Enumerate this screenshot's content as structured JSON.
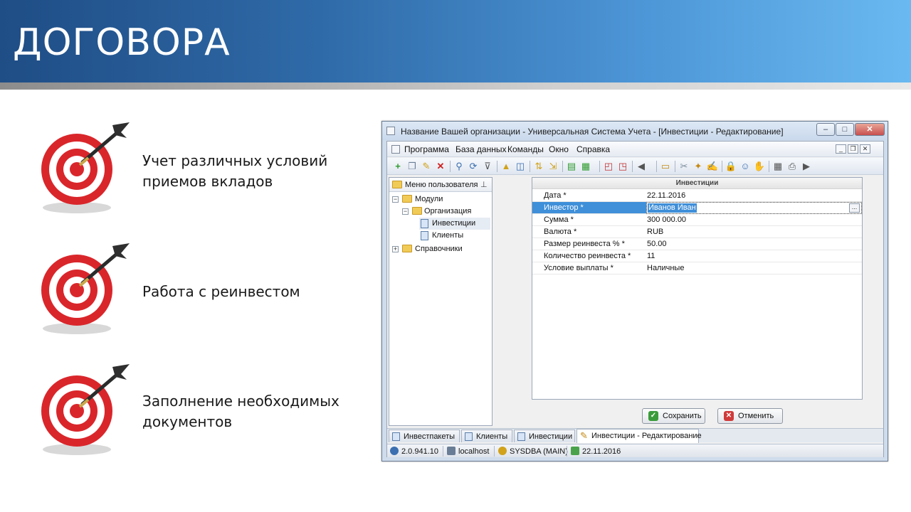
{
  "slide": {
    "title": "ДОГОВОРА",
    "bullets": [
      {
        "line1": "Учет различных условий",
        "line2": "приемов вкладов"
      },
      {
        "line1": "Работа с реинвестом",
        "line2": ""
      },
      {
        "line1": "Заполнение необходимых",
        "line2": "документов"
      }
    ]
  },
  "window": {
    "title": "Название Вашей организации - Универсальная Система Учета - [Инвестиции - Редактирование]",
    "controls": {
      "minimize": "–",
      "maximize": "□",
      "close": "✕"
    },
    "menu": [
      "Программа",
      "База данных",
      "Команды",
      "Окно",
      "Справка"
    ],
    "mdi_controls": {
      "minimize": "_",
      "restore": "❐",
      "close": "✕"
    }
  },
  "left_panel": {
    "header": "Меню пользователя",
    "tree": [
      {
        "label": "Модули",
        "expander": "−"
      },
      {
        "label": "Организация",
        "expander": "−"
      },
      {
        "label": "Инвестиции"
      },
      {
        "label": "Клиенты"
      },
      {
        "label": "Справочники",
        "expander": "+"
      }
    ]
  },
  "form": {
    "header": "Инвестиции",
    "rows": [
      {
        "label": "Дата *",
        "value": "22.11.2016"
      },
      {
        "label": "Инвестор *",
        "value": "Иванов Иван"
      },
      {
        "label": "Сумма *",
        "value": "300 000.00"
      },
      {
        "label": "Валюта *",
        "value": "RUB"
      },
      {
        "label": "Размер реинвеста % *",
        "value": "50.00"
      },
      {
        "label": "Количество реинвеста *",
        "value": "11"
      },
      {
        "label": "Условие выплаты *",
        "value": "Наличные"
      }
    ],
    "ellipsis": "...",
    "save_label": "Сохранить",
    "cancel_label": "Отменить"
  },
  "tabs": [
    "Инвестпакеты",
    "Клиенты",
    "Инвестиции",
    "Инвестиции - Редактирование"
  ],
  "status": {
    "version": "2.0.941.10",
    "host": "localhost",
    "user": "SYSDBA (MAIN)",
    "date": "22.11.2016"
  },
  "colors": {
    "accent": "#3f8fd9",
    "header_dark": "#1f4d85",
    "header_light": "#6ab9f1",
    "target_red": "#d9262b"
  }
}
